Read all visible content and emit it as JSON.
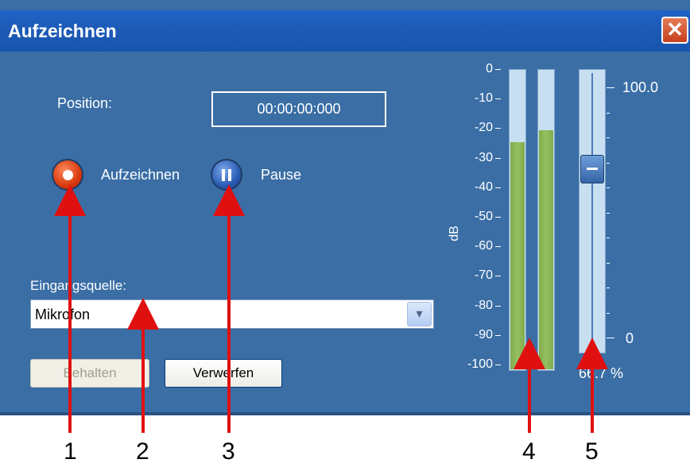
{
  "window": {
    "title": "Aufzeichnen",
    "close_glyph": "✕"
  },
  "position": {
    "label": "Position:",
    "value": "00:00:00:000"
  },
  "buttons": {
    "record_label": "Aufzeichnen",
    "pause_label": "Pause",
    "keep_label": "Behalten",
    "discard_label": "Verwerfen"
  },
  "input_source": {
    "label": "Eingangsquelle:",
    "selected": "Mikrofon",
    "arrow_glyph": "▾"
  },
  "meter": {
    "unit_label": "dB",
    "scale": [
      "0",
      "-10",
      "-20",
      "-30",
      "-40",
      "-50",
      "-60",
      "-70",
      "-80",
      "-90",
      "-100"
    ],
    "left_channel_level_db": -24,
    "right_channel_level_db": -20
  },
  "volume": {
    "max_label": "100.0",
    "min_label": "0",
    "value_label": "66.7 %",
    "value_percent": 66.7
  },
  "callouts": [
    "1",
    "2",
    "3",
    "4",
    "5"
  ],
  "colors": {
    "window_bg": "#3a6ea5",
    "titlebar": "#1d5bb8",
    "record": "#d83a10",
    "pause": "#2a5cb5",
    "meter_fill": "#8ab556",
    "arrow": "#e01010"
  }
}
